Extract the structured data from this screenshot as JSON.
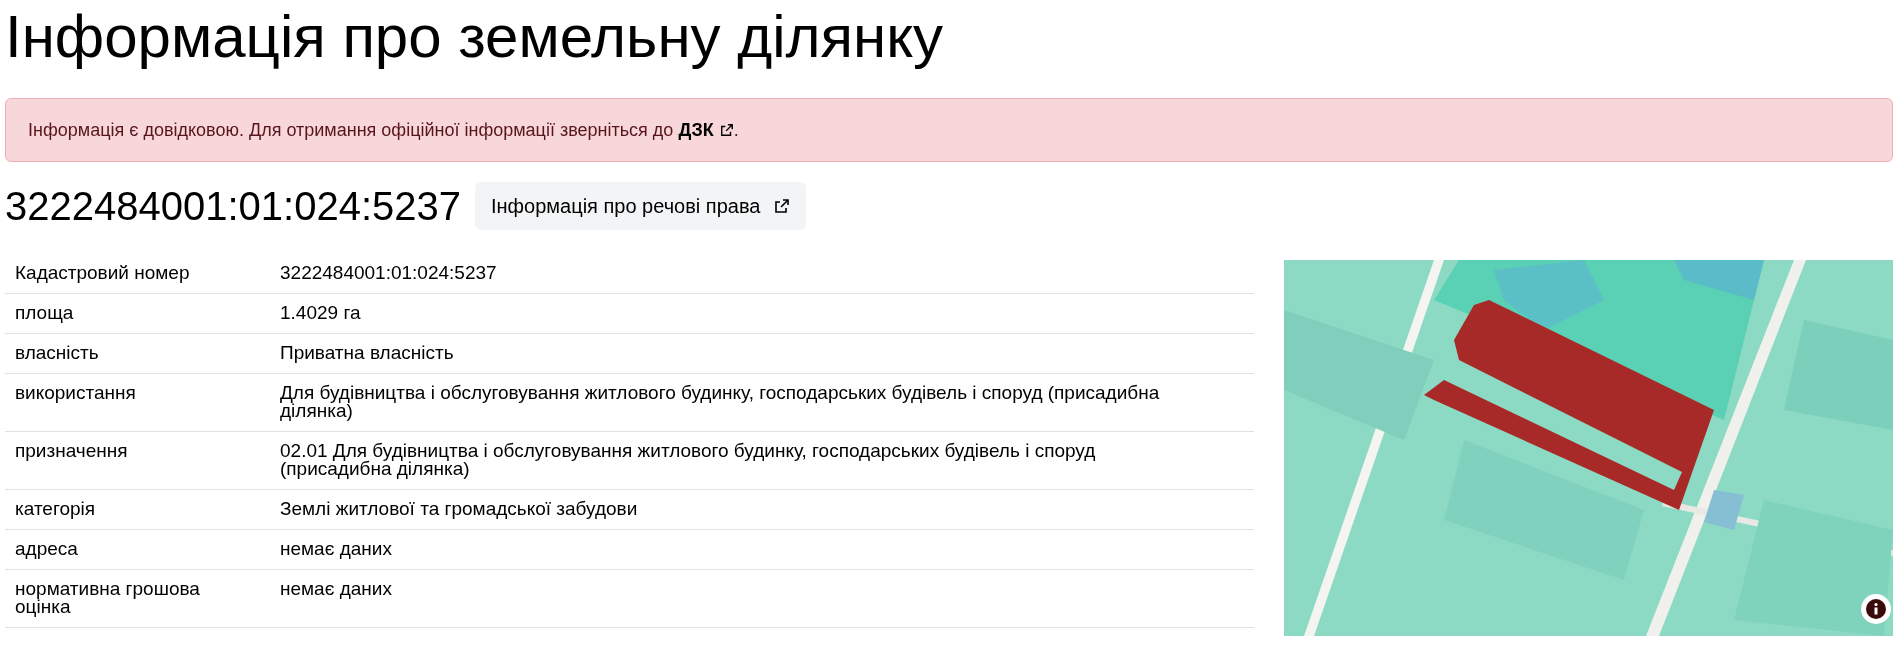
{
  "title": "Інформація про земельну ділянку",
  "notice": {
    "text": "Інформація є довідковою. Для отримання офіційної інформації зверніться до ",
    "link": "ДЗК",
    "end": "."
  },
  "parcel": {
    "number": "3222484001:01:024:5237",
    "rights_button": "Інформація про речові права"
  },
  "table": {
    "rows": [
      {
        "label": "Кадастровий номер",
        "value": "3222484001:01:024:5237"
      },
      {
        "label": "площа",
        "value": "1.4029 га"
      },
      {
        "label": "власність",
        "value": "Приватна власність"
      },
      {
        "label": "використання",
        "value": "Для будівництва і обслуговування житлового будинку, господарських будівель і споруд (присадибна ділянка)"
      },
      {
        "label": "призначення",
        "value": "02.01 Для будівництва і обслуговування житлового будинку, господарських будівель і споруд (присадибна ділянка)"
      },
      {
        "label": "категорія",
        "value": "Землі житлової та громадської забудови"
      },
      {
        "label": "адреса",
        "value": "немає даних"
      },
      {
        "label": "нормативна грошова оцінка",
        "value": "немає даних"
      }
    ]
  }
}
